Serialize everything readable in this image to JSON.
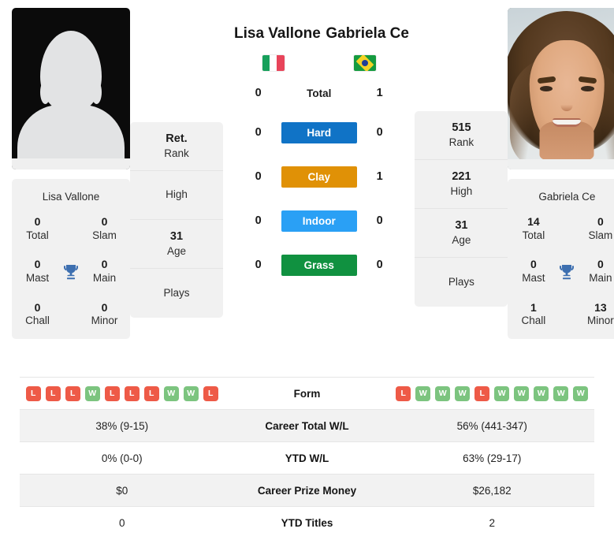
{
  "players": {
    "left": {
      "name": "Lisa Vallone",
      "country_flag": "flag-italy",
      "photo": "placeholder-avatar",
      "card_name": "Lisa Vallone",
      "titles": {
        "total_value": "0",
        "total_label": "Total",
        "slam_value": "0",
        "slam_label": "Slam",
        "mast_value": "0",
        "mast_label": "Mast",
        "main_value": "0",
        "main_label": "Main",
        "chall_value": "0",
        "chall_label": "Chall",
        "minor_value": "0",
        "minor_label": "Minor"
      },
      "ranking": {
        "rank_value": "Ret.",
        "rank_label": "Rank",
        "high_value": "",
        "high_label": "High",
        "age_value": "31",
        "age_label": "Age",
        "plays_value": "",
        "plays_label": "Plays"
      },
      "h2h": {
        "total": "0",
        "hard": "0",
        "clay": "0",
        "indoor": "0",
        "grass": "0"
      },
      "form": [
        "L",
        "L",
        "L",
        "W",
        "L",
        "L",
        "L",
        "W",
        "W",
        "L"
      ],
      "career_total_wl": "38% (9-15)",
      "ytd_wl": "0% (0-0)",
      "career_prize_money": "$0",
      "ytd_titles": "0"
    },
    "right": {
      "name": "Gabriela Ce",
      "country_flag": "flag-brazil",
      "photo": "player-portrait",
      "card_name": "Gabriela Ce",
      "titles": {
        "total_value": "14",
        "total_label": "Total",
        "slam_value": "0",
        "slam_label": "Slam",
        "mast_value": "0",
        "mast_label": "Mast",
        "main_value": "0",
        "main_label": "Main",
        "chall_value": "1",
        "chall_label": "Chall",
        "minor_value": "13",
        "minor_label": "Minor"
      },
      "ranking": {
        "rank_value": "515",
        "rank_label": "Rank",
        "high_value": "221",
        "high_label": "High",
        "age_value": "31",
        "age_label": "Age",
        "plays_value": "",
        "plays_label": "Plays"
      },
      "h2h": {
        "total": "1",
        "hard": "0",
        "clay": "1",
        "indoor": "0",
        "grass": "0"
      },
      "form": [
        "L",
        "W",
        "W",
        "W",
        "L",
        "W",
        "W",
        "W",
        "W",
        "W"
      ],
      "career_total_wl": "56% (441-347)",
      "ytd_wl": "63% (29-17)",
      "career_prize_money": "$26,182",
      "ytd_titles": "2"
    }
  },
  "surfaces": [
    {
      "key": "total",
      "label": "Total",
      "styled": false,
      "color": ""
    },
    {
      "key": "hard",
      "label": "Hard",
      "styled": true,
      "color": "#1073c6"
    },
    {
      "key": "clay",
      "label": "Clay",
      "styled": true,
      "color": "#e09106"
    },
    {
      "key": "indoor",
      "label": "Indoor",
      "styled": true,
      "color": "#2aa0f5"
    },
    {
      "key": "grass",
      "label": "Grass",
      "styled": true,
      "color": "#109140"
    }
  ],
  "trophy_icon_color": "#3d6fb0",
  "stats_rows": [
    {
      "label": "Form"
    },
    {
      "label": "Career Total W/L"
    },
    {
      "label": "YTD W/L"
    },
    {
      "label": "Career Prize Money"
    },
    {
      "label": "YTD Titles"
    }
  ]
}
